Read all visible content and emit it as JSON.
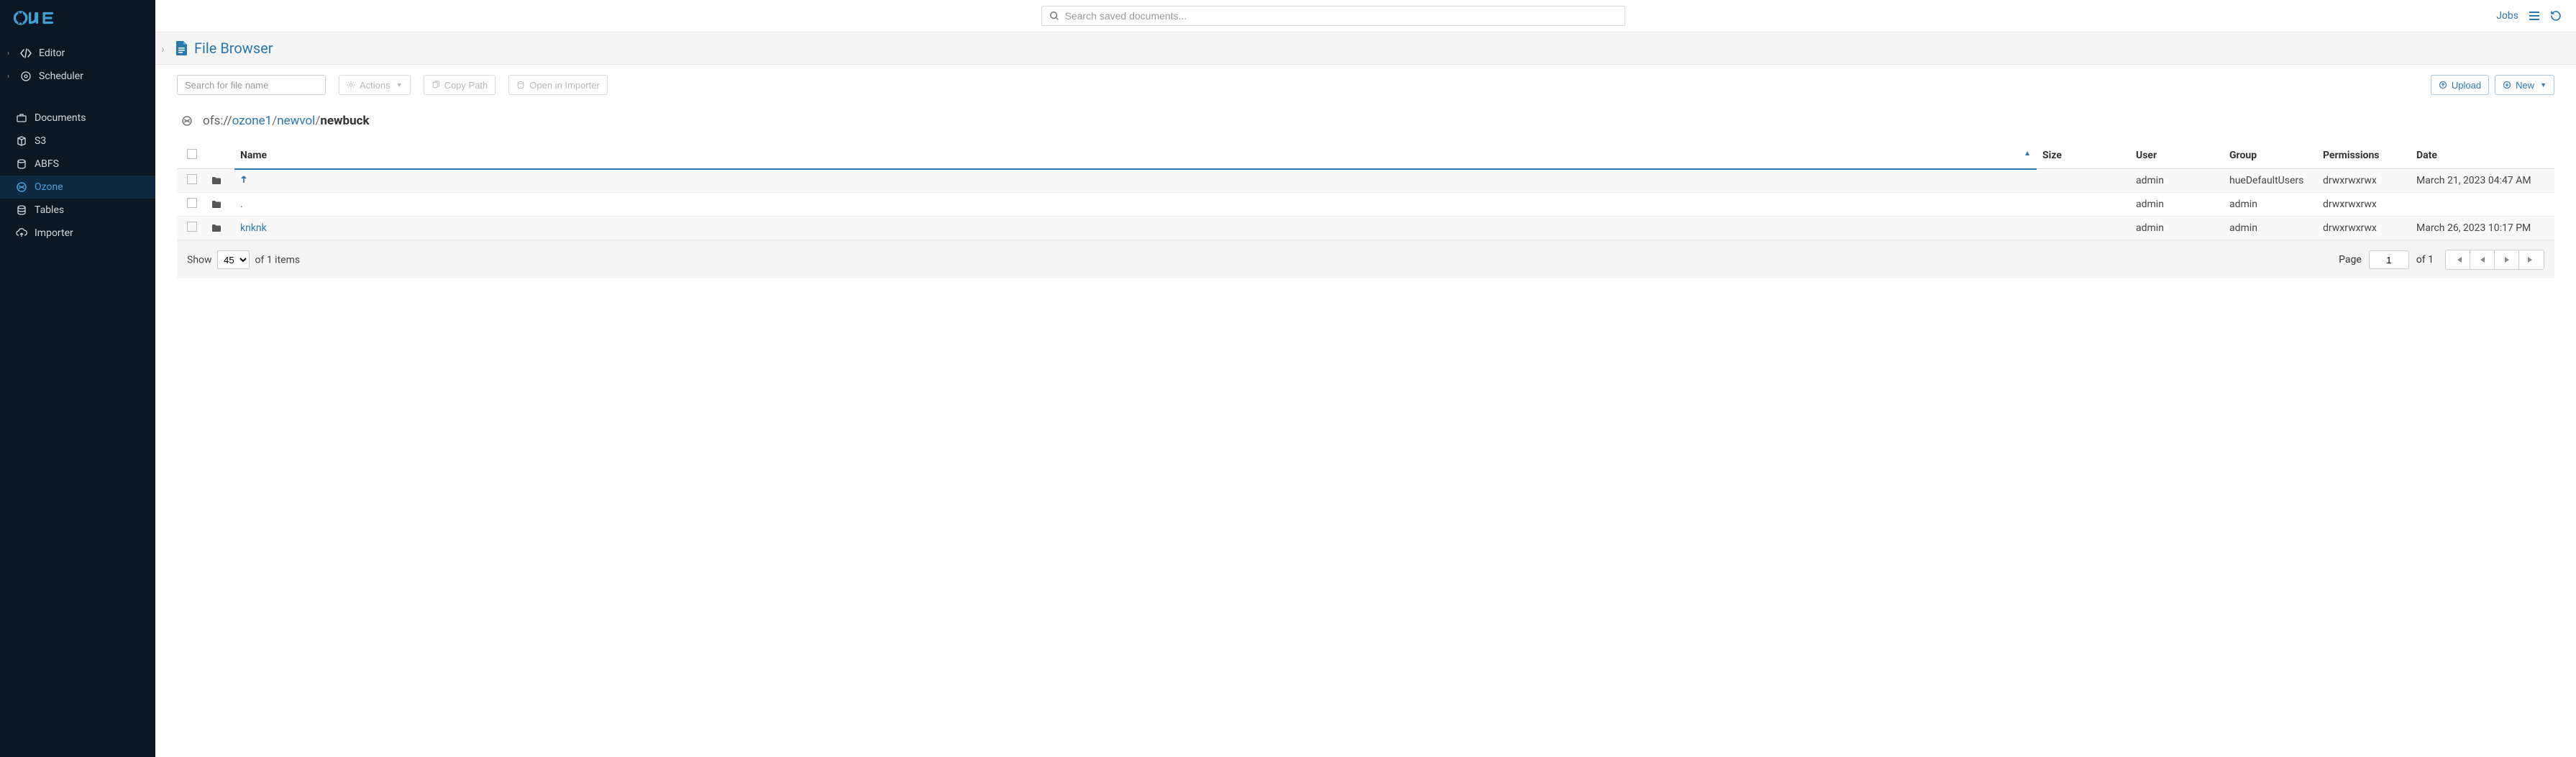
{
  "header": {
    "search_placeholder": "Search saved documents...",
    "jobs_label": "Jobs"
  },
  "sidebar": {
    "editor": "Editor",
    "scheduler": "Scheduler",
    "documents": "Documents",
    "s3": "S3",
    "abfs": "ABFS",
    "ozone": "Ozone",
    "tables": "Tables",
    "importer": "Importer"
  },
  "page": {
    "title": "File Browser",
    "file_search_placeholder": "Search for file name",
    "actions_label": "Actions",
    "copy_path_label": "Copy Path",
    "open_importer_label": "Open in Importer",
    "upload_label": "Upload",
    "new_label": "New"
  },
  "path": {
    "scheme": "ofs://",
    "seg1": "ozone1",
    "seg2": "newvol",
    "current": "newbuck"
  },
  "table": {
    "cols": {
      "name": "Name",
      "size": "Size",
      "user": "User",
      "group": "Group",
      "permissions": "Permissions",
      "date": "Date"
    },
    "rows": [
      {
        "name_up": true,
        "user": "admin",
        "group": "hueDefaultUsers",
        "perm": "drwxrwxrwx",
        "date": "March 21, 2023 04:47 AM"
      },
      {
        "name": ".",
        "user": "admin",
        "group": "admin",
        "perm": "drwxrwxrwx",
        "date": ""
      },
      {
        "name": "knknk",
        "link": true,
        "user": "admin",
        "group": "admin",
        "perm": "drwxrwxrwx",
        "date": "March 26, 2023 10:17 PM"
      }
    ]
  },
  "footer": {
    "show_label": "Show",
    "page_size": "45",
    "of_items": "of 1 items",
    "page_label": "Page",
    "page_value": "1",
    "of_pages": "of 1"
  }
}
